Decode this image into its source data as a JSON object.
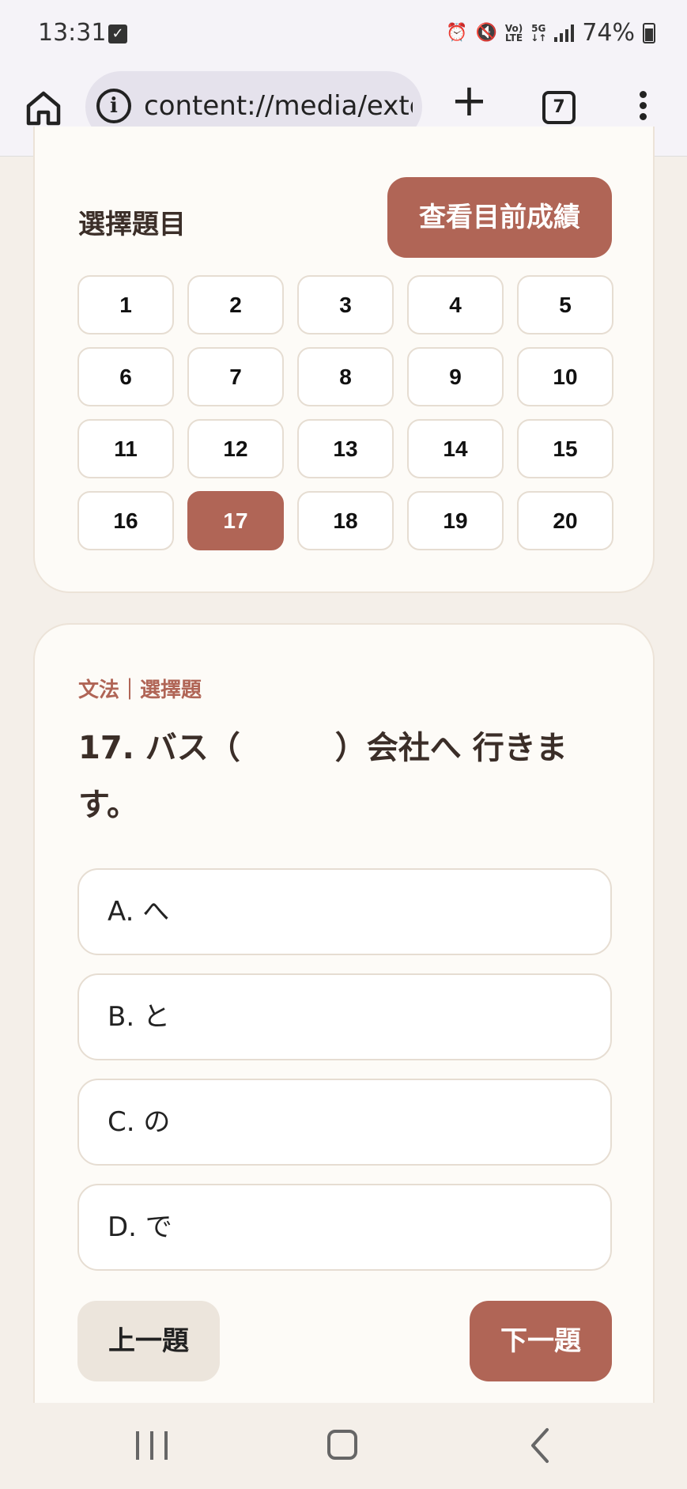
{
  "status_bar": {
    "time": "13:31",
    "battery": "74%",
    "network_top": "Vo)",
    "network_bottom": "LTE",
    "gen": "5G"
  },
  "browser": {
    "url": "content://media/exte",
    "tab_count": "7"
  },
  "selector": {
    "title": "選擇題目",
    "score_button": "查看目前成績",
    "numbers": [
      "1",
      "2",
      "3",
      "4",
      "5",
      "6",
      "7",
      "8",
      "9",
      "10",
      "11",
      "12",
      "13",
      "14",
      "15",
      "16",
      "17",
      "18",
      "19",
      "20"
    ],
    "active": "17"
  },
  "question": {
    "category": "文法｜選擇題",
    "text": "17. バス（　　　）会社へ 行きます。",
    "options": [
      {
        "label": "A. へ"
      },
      {
        "label": "B. と"
      },
      {
        "label": "C. の"
      },
      {
        "label": "D. で"
      }
    ],
    "prev_label": "上一題",
    "next_label": "下一題"
  },
  "colors": {
    "accent": "#b06556",
    "card_bg": "#fdfbf7",
    "page_bg": "#f4efe9"
  }
}
